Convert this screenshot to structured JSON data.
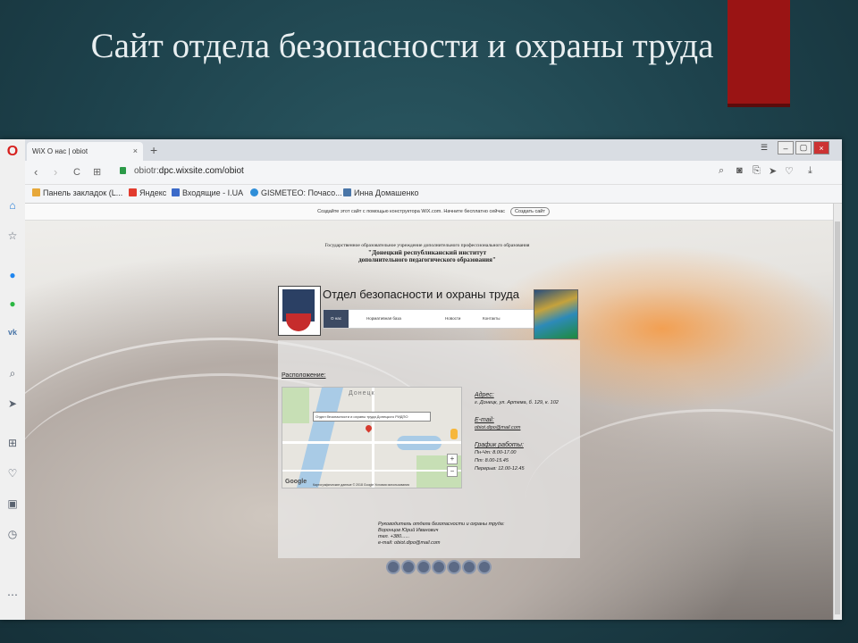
{
  "slide": {
    "title": "Сайт отдела безопасности и охраны труда",
    "accent_color": "#9a1414"
  },
  "browser": {
    "tab_title": "WiX О нас | obiot",
    "tab_close": "×",
    "new_tab": "+",
    "window_buttons": [
      "–",
      "▢",
      "×"
    ],
    "nav": {
      "back": "‹",
      "forward": "›",
      "reload": "C",
      "grid": "⊞",
      "lock": "🔒"
    },
    "url_prefix": "obiotr",
    "url_host": "dpc.wixsite.com/obiot",
    "toolbar_icons": [
      "zoom-icon",
      "camera-icon",
      "share-icon",
      "send-icon",
      "heart-icon",
      "download-icon"
    ],
    "bookmarks": [
      {
        "label": "Панель закладок (L...",
        "icon": "folder-icon",
        "color": "#e7a83a"
      },
      {
        "label": "Яндекс",
        "icon": "yandex-icon",
        "color": "#e23b2e"
      },
      {
        "label": "Входящие - I.UA",
        "icon": "mail-icon",
        "color": "#3b6ac9"
      },
      {
        "label": "GISMETEO: Почасо...",
        "icon": "weather-icon",
        "color": "#2f8ed8"
      },
      {
        "label": "Инна Домашенко",
        "icon": "vk-icon",
        "color": "#4a76a8"
      }
    ],
    "sidebar_icons": [
      "opera-icon",
      "home-icon",
      "star-icon",
      "messenger-icon",
      "whatsapp-icon",
      "vk-icon",
      "search-icon",
      "send-icon",
      "grid-icon",
      "heart-icon",
      "wallet-icon",
      "history-icon",
      "more-icon"
    ]
  },
  "site": {
    "wix_notice": "Создайте этот сайт с помощью конструктора WiX.com. Начните бесплатно сейчас",
    "wix_button": "Создать сайт",
    "institution": {
      "line1": "Государственное образовательное учреждение дополнительного профессионального образования",
      "line2": "\"Донецкий республиканский институт",
      "line3": "дополнительного педагогического образования\""
    },
    "dept_title": "Отдел безопасности и охраны труда",
    "nav": [
      "О нас",
      "Нормативная база",
      "Новости",
      "Контакты"
    ],
    "location_label": "Расположение:",
    "map": {
      "city_label": "Донецк",
      "popup": "Отдел безопасности и охраны труда Донецкого РИДПО",
      "zoom_in": "+",
      "zoom_out": "−",
      "google": "Google",
      "footer": "Картографические данные © 2018 Google   Условия использования"
    },
    "contact": {
      "address_h": "Адрес:",
      "address": "г. Донецк, ул. Артема, б. 129, к. 102",
      "email_h": "E-mail:",
      "email": "obiot.dipo@mail.com",
      "schedule_h": "График работы:",
      "schedule": [
        "Пн-Чт: 8.00-17.00",
        "Пт: 8.00-15.45",
        "Перерыв: 12.00-12.45"
      ]
    },
    "responsible": [
      "Руководитель отдела безопасности и охраны труда:",
      "Воронцов Юрий Иванович",
      "тел. +380......",
      "e-mail: obiot.dipo@mail.com"
    ],
    "social_count": 7
  }
}
